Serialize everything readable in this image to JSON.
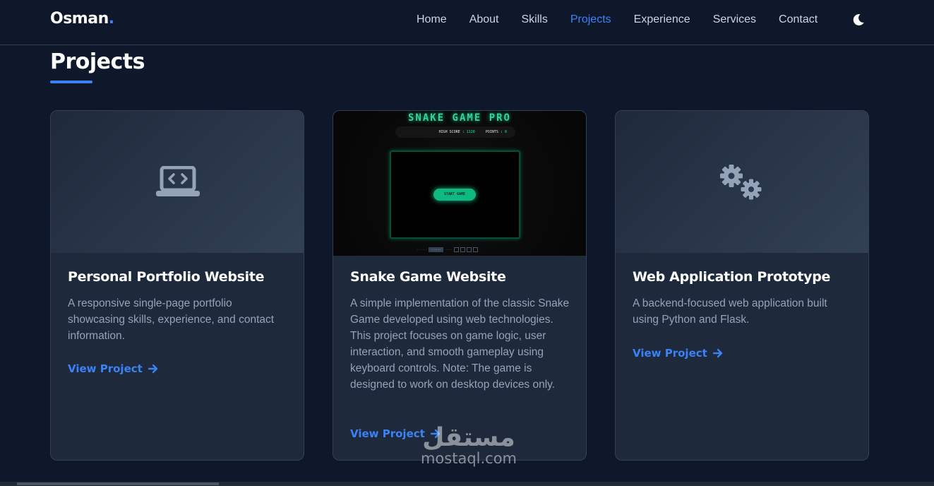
{
  "navbar": {
    "logo_text": "Osman",
    "logo_dot": ".",
    "links": [
      {
        "label": "Home"
      },
      {
        "label": "About"
      },
      {
        "label": "Skills"
      },
      {
        "label": "Projects"
      },
      {
        "label": "Experience"
      },
      {
        "label": "Services"
      },
      {
        "label": "Contact"
      }
    ],
    "active_link": "Projects",
    "theme_icon": "moon-icon"
  },
  "section": {
    "title": "Projects"
  },
  "projects": [
    {
      "media_icon": "laptop-code-icon",
      "title": "Personal Portfolio Website",
      "description": "A responsive single-page portfolio showcasing skills, experience, and contact information.",
      "link_label": "View Project"
    },
    {
      "media_icon": "snake-game-screenshot",
      "title": "Snake Game Website",
      "description": "A simple implementation of the classic Snake Game developed using web technologies. This project focuses on game logic, user interaction, and smooth gameplay using keyboard controls. Note: The game is designed to work on desktop devices only.",
      "link_label": "View Project",
      "screenshot": {
        "title": "SNAKE GAME PRO",
        "high_score_label": "HIGH SCORE :",
        "high_score_value": "1120",
        "points_label": "POINTS :",
        "points_value": "0",
        "start_label": "START GAME"
      }
    },
    {
      "media_icon": "gears-icon",
      "title": "Web Application Prototype",
      "description": "A backend-focused web application built using Python and Flask.",
      "link_label": "View Project"
    }
  ],
  "watermark": {
    "arabic": "مستقل",
    "latin": "mostaql.com"
  },
  "colors": {
    "background": "#0f172a",
    "card": "#1e293b",
    "accent": "#3b82f6",
    "text_muted": "#94a3b8",
    "snake_green": "#10b981"
  }
}
